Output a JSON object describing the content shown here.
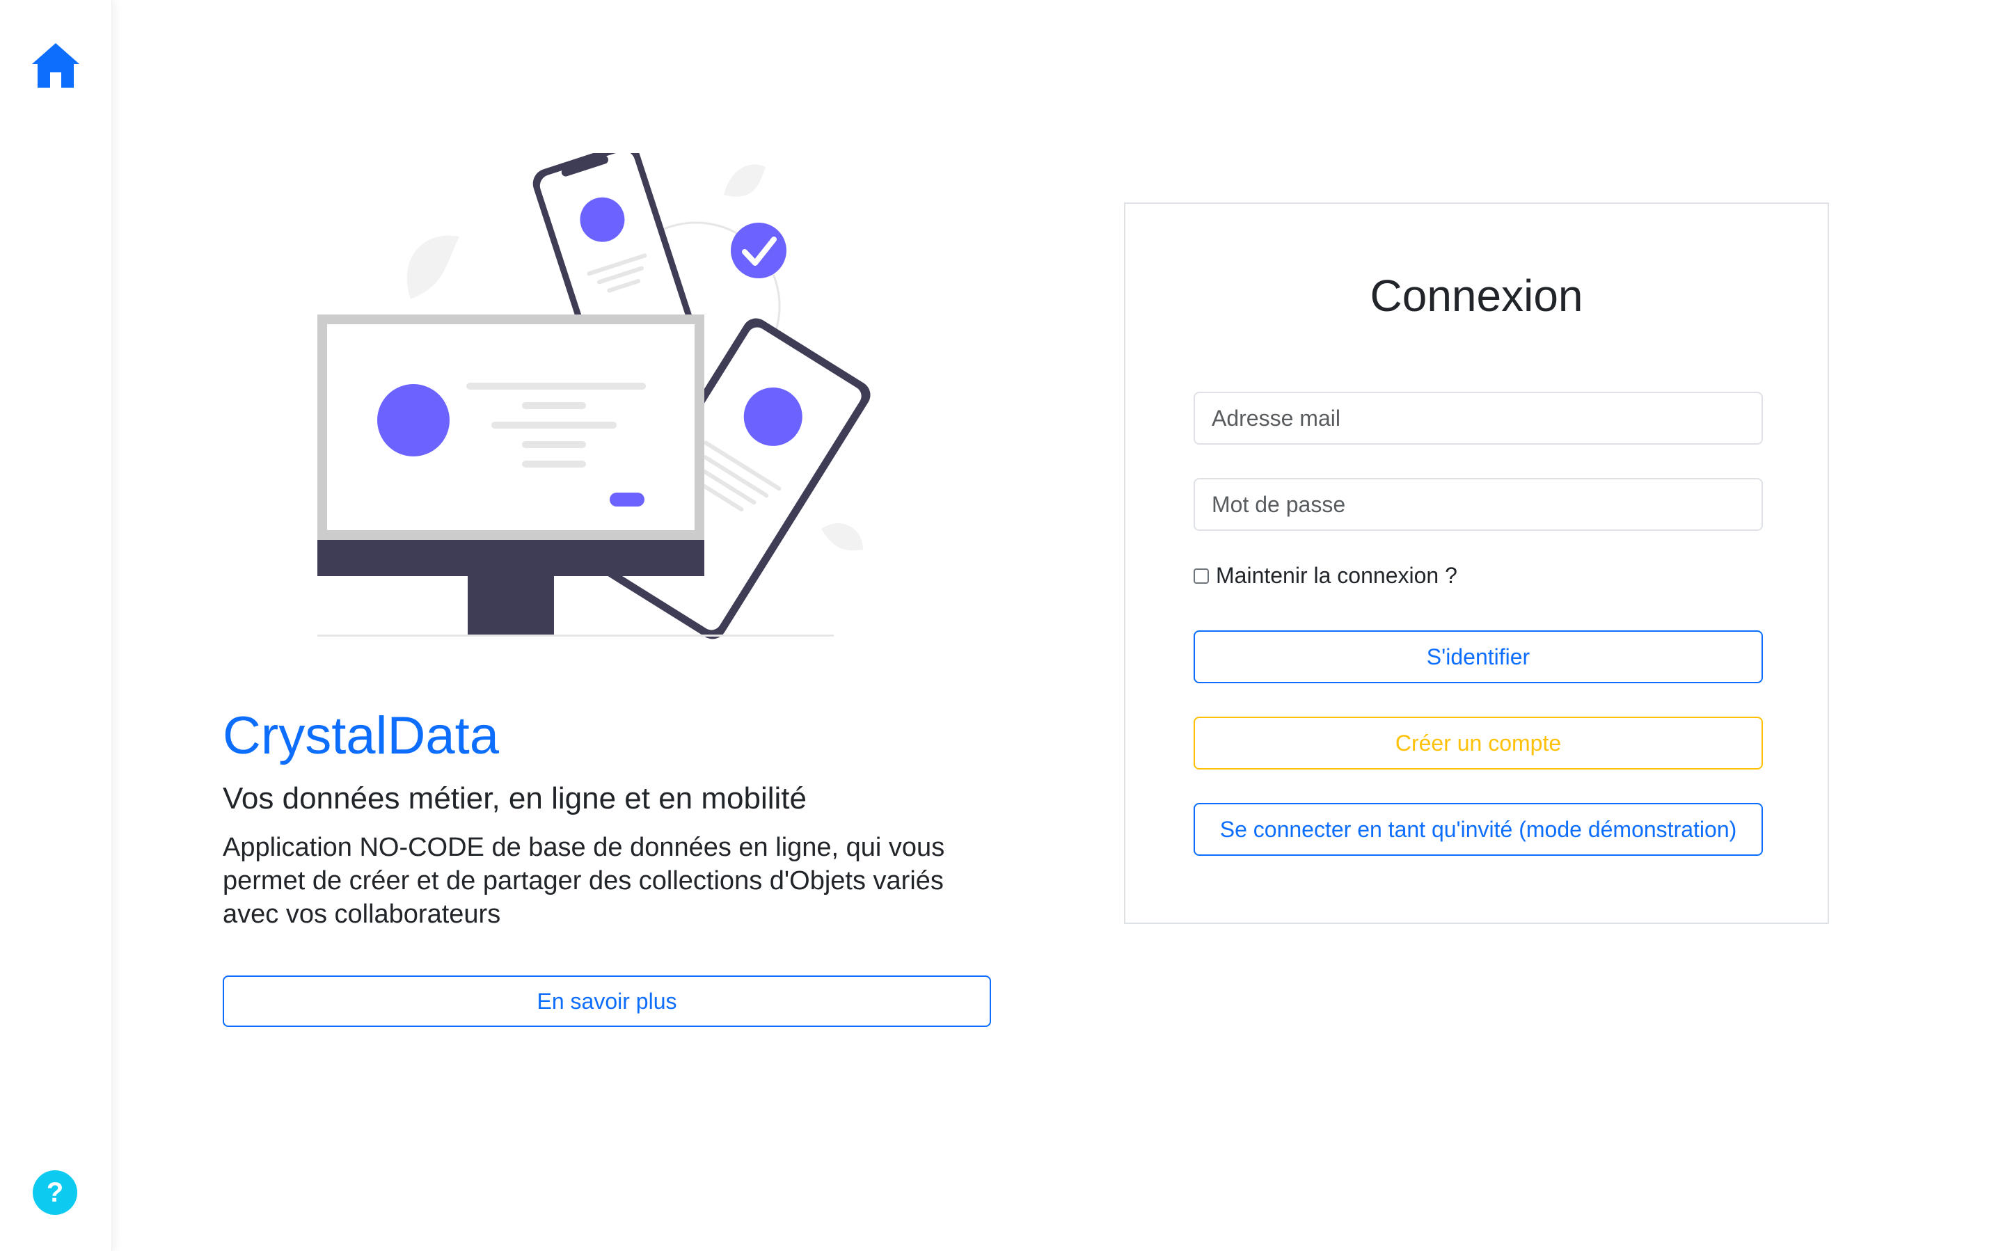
{
  "sidebar": {
    "home_icon": "home-icon",
    "help_icon": "question-icon",
    "help_label": "?"
  },
  "hero": {
    "brand": "CrystalData",
    "tagline": "Vos données métier, en ligne et en mobilité",
    "description": "Application NO-CODE de base de données en ligne, qui vous permet de créer et de partager des collections d'Objets variés avec vos collaborateurs",
    "learn_more_label": "En savoir plus"
  },
  "login": {
    "title": "Connexion",
    "email_placeholder": "Adresse mail",
    "email_value": "",
    "password_placeholder": "Mot de passe",
    "password_value": "",
    "remember_label": "Maintenir la connexion ?",
    "remember_checked": false,
    "login_label": "S'identifier",
    "create_account_label": "Créer un compte",
    "guest_label": "Se connecter en tant qu'invité (mode démonstration)"
  },
  "colors": {
    "primary": "#0d6efd",
    "warning": "#ffc107",
    "info": "#0dcaf0",
    "illustration_accent": "#6c63ff",
    "illustration_dark": "#3f3d56"
  }
}
